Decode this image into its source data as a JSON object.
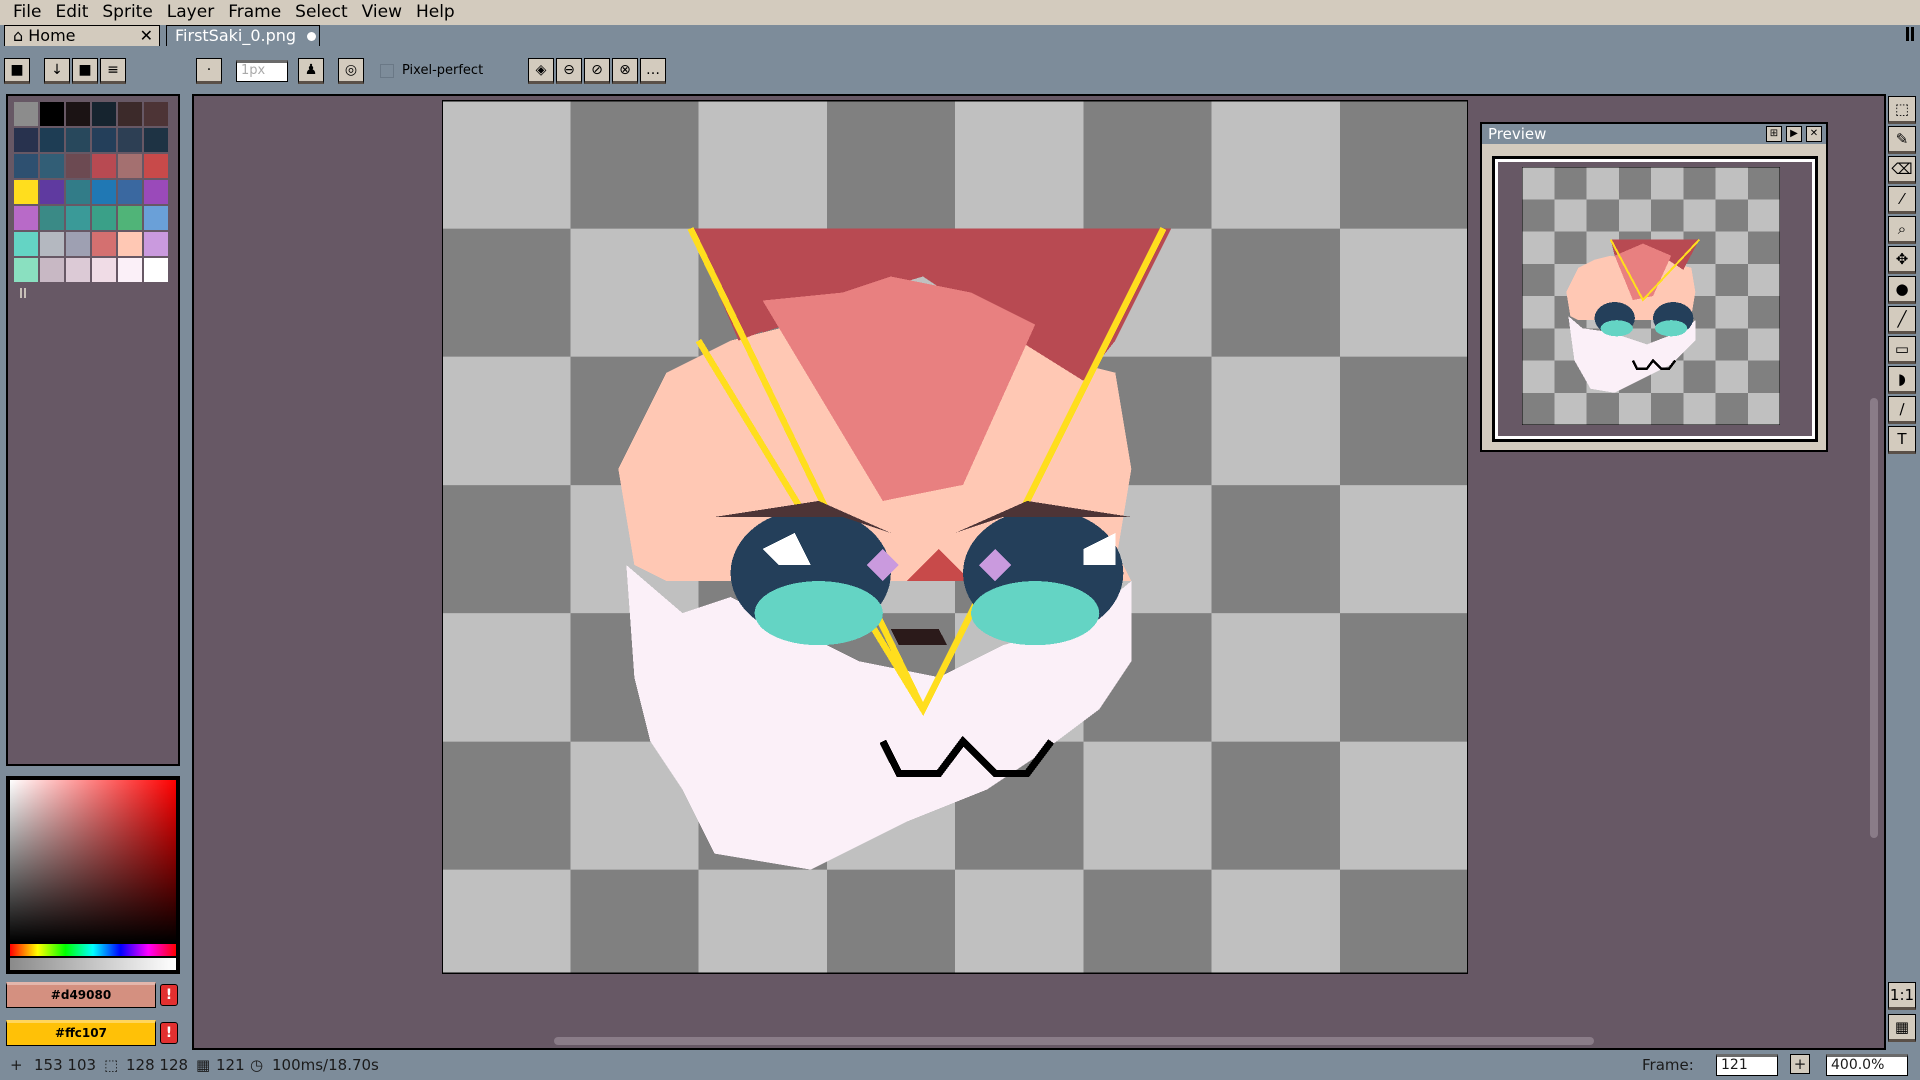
{
  "menu": [
    "File",
    "Edit",
    "Sprite",
    "Layer",
    "Frame",
    "Select",
    "View",
    "Help"
  ],
  "tabs": {
    "home": "Home",
    "file": "FirstSaki_0.png",
    "close_glyph": "✕"
  },
  "toolbar": {
    "brush_size_placeholder": "1px",
    "pixel_perfect_label": "Pixel-perfect"
  },
  "palette": {
    "colors": [
      "#8c8c8c",
      "#000000",
      "#1b1314",
      "#16242f",
      "#3c2a2a",
      "#4d3436",
      "#28324e",
      "#1e3d54",
      "#28485c",
      "#243f5a",
      "#2d3f54",
      "#1e3344",
      "#2e5070",
      "#325e76",
      "#6c4a52",
      "#b84a52",
      "#a47070",
      "#c84a4a",
      "#ffde1e",
      "#5f3aa0",
      "#327c88",
      "#2078b4",
      "#3a68a0",
      "#9a4aba",
      "#b86ac8",
      "#3a8a86",
      "#3a9a98",
      "#3aa088",
      "#50b478",
      "#6aa0d8",
      "#64d4c4",
      "#b4b8c0",
      "#9ea0b2",
      "#d47070",
      "#ffc8b4",
      "#ca9ade",
      "#8ae0c0",
      "#c8b8c4",
      "#dccad6",
      "#f0dce6",
      "#fbf0f8",
      "#ffffff"
    ]
  },
  "colors": {
    "foreground": "#d49080",
    "background": "#ffc107",
    "warning_glyph": "!"
  },
  "preview": {
    "title": "Preview"
  },
  "status": {
    "cursor": "153 103",
    "selection": "128 128",
    "frame_total": "121",
    "duration": "100ms/18.70s",
    "frame_label": "Frame:",
    "frame_value": "121",
    "zoom": "400.0%"
  }
}
